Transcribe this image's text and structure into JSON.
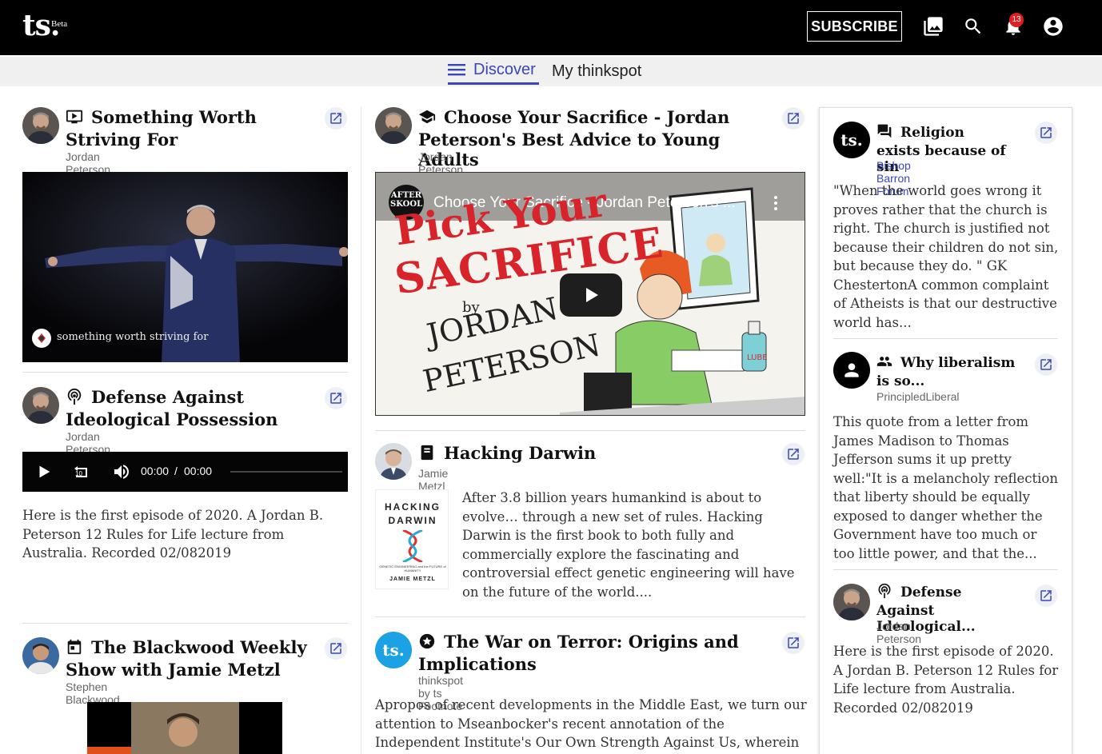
{
  "header": {
    "logo": "ts.",
    "beta": "Beta",
    "subscribe": "SUBSCRIBE",
    "notification_count": "13",
    "icons": [
      "library-icon",
      "search-icon",
      "bell-icon",
      "account-icon"
    ]
  },
  "nav": {
    "discover": "Discover",
    "my_thinkspot": "My thinkspot"
  },
  "col1": [
    {
      "title": "Something Worth Striving For",
      "author": "Jordan Peterson",
      "type_icon": "video-icon",
      "video_caption": "something worth striving for"
    },
    {
      "title": "Defense Against Ideological Possession",
      "author": "Jordan Peterson",
      "type_icon": "podcast-icon",
      "audio_time": "00:00",
      "audio_sep": "/",
      "audio_duration": "00:00",
      "skip_label": "10",
      "body": "Here is the first episode of 2020. A Jordan B. Peterson 12 Rules for Life lecture from Australia. Recorded 02/082019"
    },
    {
      "title": "The Blackwood Weekly Show with Jamie Metzl",
      "author": "Stephen Blackwood",
      "type_icon": "calendar-icon"
    }
  ],
  "col2": [
    {
      "title": "Choose Your Sacrifice - Jordan Peterson's Best Advice to Young Adults",
      "author": "Jordan Peterson",
      "type_icon": "course-icon",
      "video_title": "Choose Your Sacrifice - Jordan Peterson's ...",
      "thumb_line1": "Pick Your",
      "thumb_line2": "SACRIFICE",
      "thumb_by": "by",
      "thumb_name1": "JORDAN",
      "thumb_name2": "PETERSON",
      "channel_badge": "AFTER SKOOL",
      "lube": "LUBE"
    },
    {
      "title": "Hacking Darwin",
      "author": "Jamie Metzl",
      "type_icon": "book-icon",
      "book_line1": "HACKING",
      "book_line2": "DARWIN",
      "book_sub": "GENETIC ENGINEERING and the FUTURE of HUMANITY",
      "book_author": "JAMIE METZL",
      "body": "After 3.8 billion years humankind is about to evolve… through a new set of rules. Hacking Darwin is the first book to both fully and commercially explore the fascinating and controversial effect genetic engineering will have on the future of the world...."
    },
    {
      "title": "The War on Terror: Origins and Implications",
      "author": "thinkspot by ts Footnote",
      "type_icon": "star-badge-icon",
      "avatar_text": "ts.",
      "body": "Apropos of recent developments in the Middle East, we turn our attention to Mseanbocker's recent annotation of the Independent Institute's Our Own Strength Against Us, wherein assumptions about"
    }
  ],
  "sidebar": [
    {
      "title": "Religion exists because of sin",
      "author": "Bishop Barron Forum",
      "type_icon": "chat-icon",
      "avatar_text": "ts.",
      "body": "\"When the world goes wrong it proves rather that the church is right. The church is justified not because their children do not sin, but because they do. \" GK ChestertonA common complaint of Atheists is that our destructive world has..."
    },
    {
      "title": "Why liberalism is so...",
      "author": "PrincipledLiberal",
      "type_icon": "group-icon",
      "body": "This quote from a letter from James Madison to Thomas Jefferson sums it up pretty well:\"It is a melancholy reflection that liberty should be equally exposed to danger whether the Government have too much or too little power, and that the..."
    },
    {
      "title": "Defense Against Ideological...",
      "author": "Jordan Peterson",
      "type_icon": "podcast-icon",
      "body": "Here is the first episode of 2020. A Jordan B. Peterson 12 Rules for Life lecture from Australia. Recorded 02/082019"
    }
  ],
  "colors": {
    "accent": "#3b46b8",
    "header_bg": "#000000",
    "badge": "#e02020",
    "ts_blue": "#1da1e5"
  }
}
